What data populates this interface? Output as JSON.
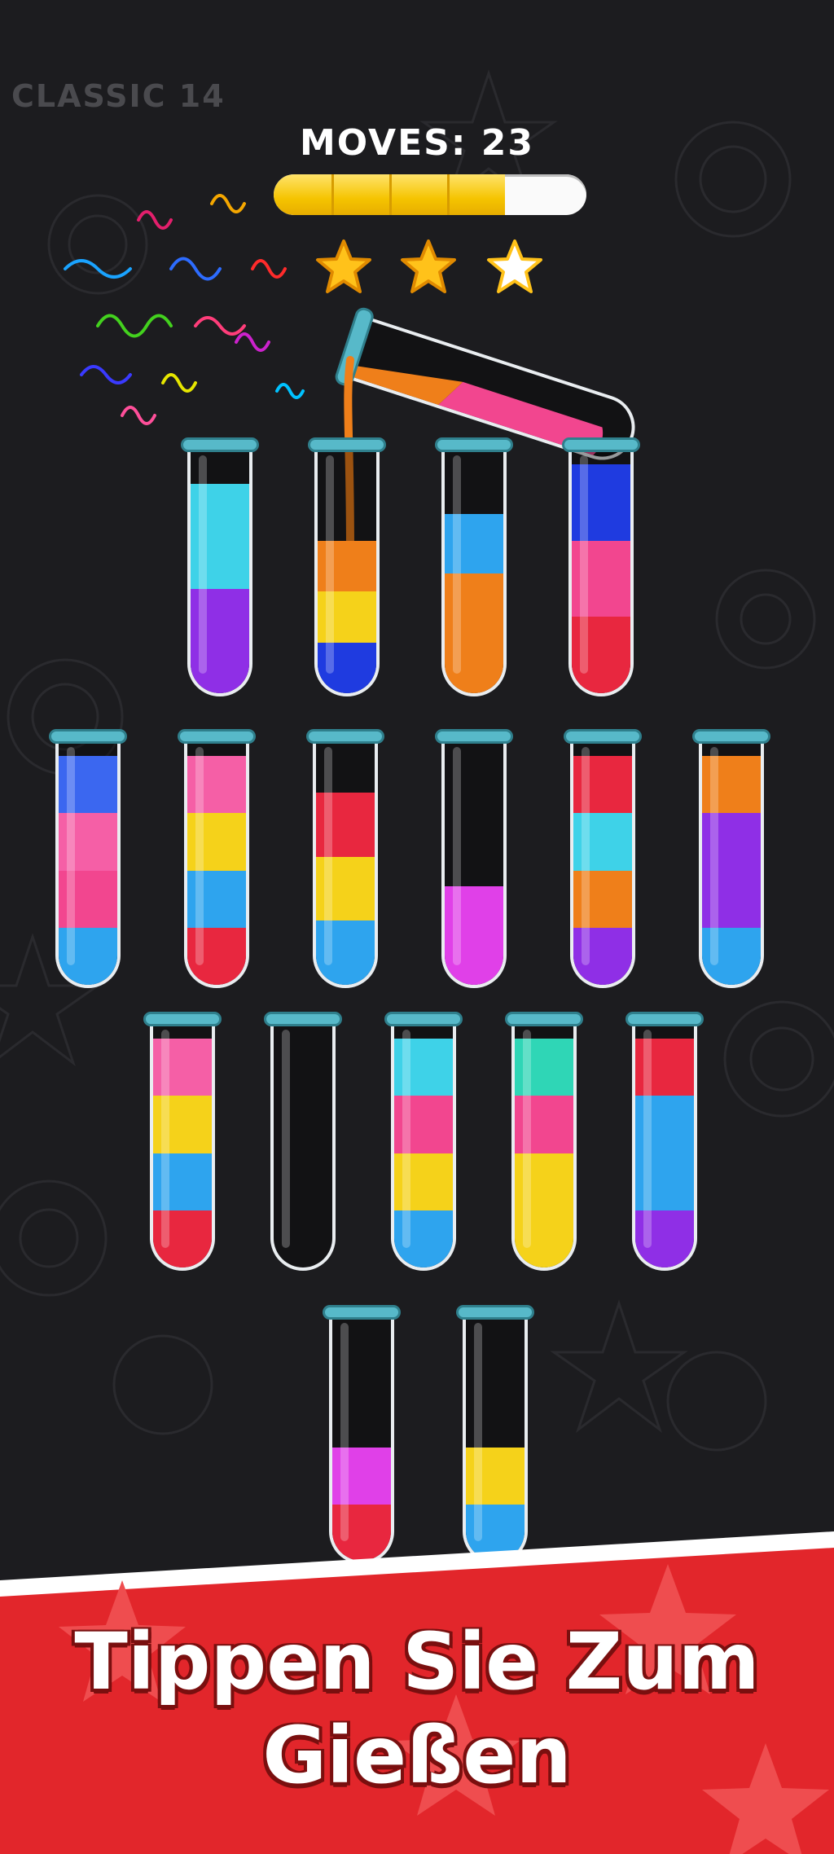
{
  "level_label": "CLASSIC 14",
  "moves": {
    "label": "MOVES:",
    "value": "23"
  },
  "progress": {
    "fraction": 0.74,
    "segments": 4
  },
  "stars": {
    "earned": 2,
    "total": 3
  },
  "colors": {
    "background": "#1c1c1f",
    "cyan": "#3ed2e8",
    "purple": "#8f2fe6",
    "orange": "#ef7f1a",
    "yellow": "#f5d21a",
    "blue": "#1f3be0",
    "skyblue": "#2ea4ee",
    "blue2": "#3b67f0",
    "pink": "#f2468f",
    "lightpink": "#f55fa6",
    "red": "#e8273f",
    "magenta": "#e040e8",
    "teal": "#2fd6b6",
    "banner_red": "#e2262b"
  },
  "tubes": [
    {
      "layers": [
        "purple",
        "cyan"
      ],
      "fill": 0.85
    },
    {
      "layers": [
        "blue",
        "yellow",
        "orange"
      ],
      "fill": 0.62
    },
    {
      "layers": [
        "orange",
        "orange",
        "skyblue"
      ],
      "fill": 0.73
    },
    {
      "layers": [
        "red",
        "pink",
        "blue"
      ],
      "fill": 0.93
    },
    {
      "layers": [
        "skyblue",
        "pink",
        "lightpink",
        "blue2"
      ],
      "fill": 0.93
    },
    {
      "layers": [
        "red",
        "skyblue",
        "yellow",
        "lightpink"
      ],
      "fill": 0.93
    },
    {
      "layers": [
        "skyblue",
        "yellow",
        "red"
      ],
      "fill": 0.78
    },
    {
      "layers": [
        "magenta"
      ],
      "fill": 0.4
    },
    {
      "layers": [
        "purple",
        "orange",
        "cyan",
        "red"
      ],
      "fill": 0.93
    },
    {
      "layers": [
        "skyblue",
        "purple",
        "purple",
        "orange"
      ],
      "fill": 0.93
    },
    {
      "layers": [
        "red",
        "skyblue",
        "yellow",
        "lightpink"
      ],
      "fill": 0.93
    },
    {
      "layers": [],
      "fill": 0.0
    },
    {
      "layers": [
        "skyblue",
        "yellow",
        "pink",
        "cyan"
      ],
      "fill": 0.93
    },
    {
      "layers": [
        "yellow",
        "yellow",
        "pink",
        "teal"
      ],
      "fill": 0.93
    },
    {
      "layers": [
        "purple",
        "skyblue",
        "skyblue",
        "red"
      ],
      "fill": 0.93
    },
    {
      "layers": [
        "red",
        "magenta"
      ],
      "fill": 0.46
    },
    {
      "layers": [
        "skyblue",
        "yellow"
      ],
      "fill": 0.46
    }
  ],
  "pouring_tube": {
    "layers": [
      "pink",
      "orange"
    ],
    "stream_color": "orange"
  },
  "banner": {
    "line1": "Tippen Sie Zum",
    "line2": "Gießen"
  }
}
